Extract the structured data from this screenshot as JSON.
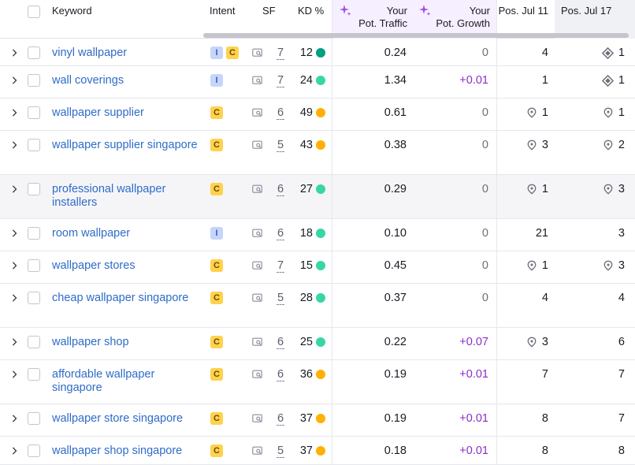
{
  "columns": {
    "keyword": "Keyword",
    "intent": "Intent",
    "sf": "SF",
    "kd": "KD %",
    "traffic_line1": "Your",
    "traffic_line2": "Pot. Traffic",
    "growth_line1": "Your",
    "growth_line2": "Pot. Growth",
    "pos_jul11": "Pos. Jul 11",
    "pos_jul17": "Pos. Jul 17"
  },
  "colors": {
    "kd_dark_green": "#009f81",
    "kd_green": "#38d6a4",
    "kd_yellow": "#ffb000",
    "link_blue": "#2f6cc8",
    "growth_purple": "#8d2ec7"
  },
  "rows": [
    {
      "keyword": "vinyl wallpaper",
      "intents": [
        "I",
        "C"
      ],
      "sf": "7",
      "kd": "12",
      "kd_color": "#009f81",
      "traffic": "0.24",
      "growth": "0",
      "pos11": "4",
      "pos11_icon": "none",
      "pos17": "1",
      "pos17_icon": "diamond-icon"
    },
    {
      "keyword": "wall coverings",
      "intents": [
        "I"
      ],
      "sf": "7",
      "kd": "24",
      "kd_color": "#38d6a4",
      "traffic": "1.34",
      "growth": "+0.01",
      "pos11": "1",
      "pos11_icon": "none",
      "pos17": "1",
      "pos17_icon": "diamond-icon"
    },
    {
      "keyword": "wallpaper supplier",
      "intents": [
        "C"
      ],
      "sf": "6",
      "kd": "49",
      "kd_color": "#ffb000",
      "traffic": "0.61",
      "growth": "0",
      "pos11": "1",
      "pos11_icon": "pin-icon",
      "pos17": "1",
      "pos17_icon": "pin-icon"
    },
    {
      "keyword": "wallpaper supplier singapore",
      "intents": [
        "C"
      ],
      "sf": "5",
      "kd": "43",
      "kd_color": "#ffb000",
      "traffic": "0.38",
      "growth": "0",
      "pos11": "3",
      "pos11_icon": "pin-icon",
      "pos17": "2",
      "pos17_icon": "pin-icon"
    },
    {
      "keyword": "professional wallpaper installers",
      "intents": [
        "C"
      ],
      "sf": "6",
      "kd": "27",
      "kd_color": "#38d6a4",
      "traffic": "0.29",
      "growth": "0",
      "pos11": "1",
      "pos11_icon": "pin-icon",
      "pos17": "3",
      "pos17_icon": "pin-icon"
    },
    {
      "keyword": "room wallpaper",
      "intents": [
        "I"
      ],
      "sf": "6",
      "kd": "18",
      "kd_color": "#38d6a4",
      "traffic": "0.10",
      "growth": "0",
      "pos11": "21",
      "pos11_icon": "none",
      "pos17": "3",
      "pos17_icon": "none"
    },
    {
      "keyword": "wallpaper stores",
      "intents": [
        "C"
      ],
      "sf": "7",
      "kd": "15",
      "kd_color": "#38d6a4",
      "traffic": "0.45",
      "growth": "0",
      "pos11": "1",
      "pos11_icon": "pin-icon",
      "pos17": "3",
      "pos17_icon": "pin-icon"
    },
    {
      "keyword": "cheap wallpaper singapore",
      "intents": [
        "C"
      ],
      "sf": "5",
      "kd": "28",
      "kd_color": "#38d6a4",
      "traffic": "0.37",
      "growth": "0",
      "pos11": "4",
      "pos11_icon": "none",
      "pos17": "4",
      "pos17_icon": "none"
    },
    {
      "keyword": "wallpaper shop",
      "intents": [
        "C"
      ],
      "sf": "6",
      "kd": "25",
      "kd_color": "#38d6a4",
      "traffic": "0.22",
      "growth": "+0.07",
      "pos11": "3",
      "pos11_icon": "pin-icon",
      "pos17": "6",
      "pos17_icon": "none"
    },
    {
      "keyword": "affordable wallpaper singapore",
      "intents": [
        "C"
      ],
      "sf": "6",
      "kd": "36",
      "kd_color": "#ffb000",
      "traffic": "0.19",
      "growth": "+0.01",
      "pos11": "7",
      "pos11_icon": "none",
      "pos17": "7",
      "pos17_icon": "none"
    },
    {
      "keyword": "wallpaper store singapore",
      "intents": [
        "C"
      ],
      "sf": "6",
      "kd": "37",
      "kd_color": "#ffb000",
      "traffic": "0.19",
      "growth": "+0.01",
      "pos11": "8",
      "pos11_icon": "none",
      "pos17": "7",
      "pos17_icon": "none"
    },
    {
      "keyword": "wallpaper shop singapore",
      "intents": [
        "C"
      ],
      "sf": "5",
      "kd": "37",
      "kd_color": "#ffb000",
      "traffic": "0.18",
      "growth": "+0.01",
      "pos11": "8",
      "pos11_icon": "none",
      "pos17": "8",
      "pos17_icon": "none"
    }
  ]
}
